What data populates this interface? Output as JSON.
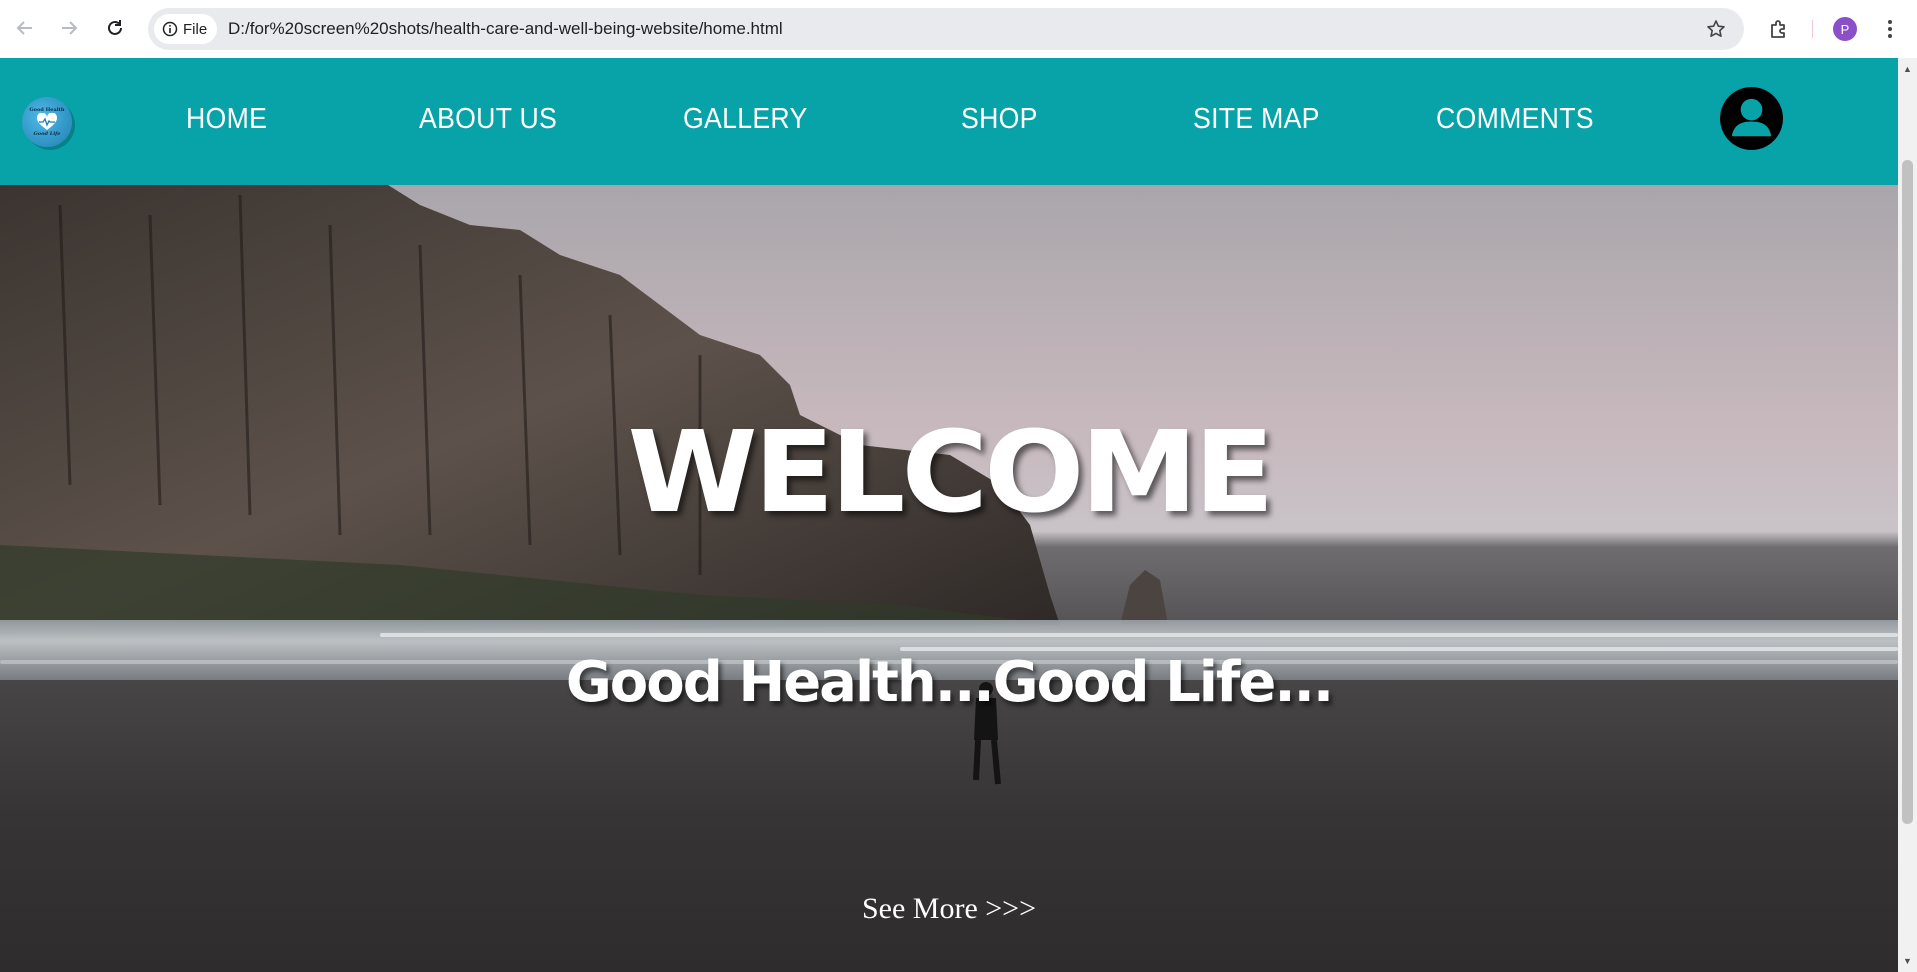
{
  "browser": {
    "site_chip_label": "File",
    "url": "D:/for%20screen%20shots/health-care-and-well-being-website/home.html",
    "profile_initial": "P"
  },
  "site": {
    "logo_text_top": "Good Health",
    "logo_text_bottom": "Good Life",
    "nav": [
      {
        "label": "HOME"
      },
      {
        "label": "ABOUT US"
      },
      {
        "label": "GALLERY"
      },
      {
        "label": "SHOP"
      },
      {
        "label": "SITE MAP"
      },
      {
        "label": "COMMENTS"
      }
    ],
    "header_color": "#08a3a9"
  },
  "hero": {
    "title": "WELCOME",
    "tagline": "Good Health...Good Life...",
    "see_more": "See More >>>"
  }
}
